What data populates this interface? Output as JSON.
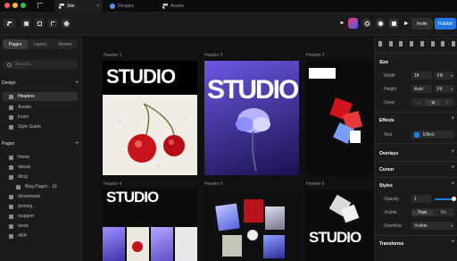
{
  "window": {
    "tabs": [
      {
        "label": "Site",
        "active": true
      },
      {
        "label": "Designs",
        "active": false
      },
      {
        "label": "Assets",
        "active": false
      }
    ]
  },
  "toolbar": {
    "invite_label": "Invite",
    "publish_label": "Publish",
    "accent": "#1e78e6"
  },
  "sidebar": {
    "tabs": [
      "Pages",
      "Layers",
      "Assets"
    ],
    "search_placeholder": "Search...",
    "design_section": "Design",
    "design_items": [
      "Headers",
      "Assets",
      "Icons",
      "Style Guide"
    ],
    "pages_section": "Pages",
    "page_items": [
      "Home",
      "/about",
      "/blog",
      "Blog Pages · 10",
      "/downloads",
      "/pricing",
      "/support",
      "/work",
      "/404"
    ]
  },
  "canvas": {
    "frames": [
      {
        "label": "Header 1",
        "heading": "STUDIO"
      },
      {
        "label": "Header 2",
        "heading": "STUDIO"
      },
      {
        "label": "Header 3",
        "heading": ""
      },
      {
        "label": "Header 4",
        "heading": "STUDIO"
      },
      {
        "label": "Header 5",
        "heading": ""
      },
      {
        "label": "Header 6",
        "heading": "STUDIO"
      }
    ]
  },
  "panel": {
    "size_title": "Size",
    "width_label": "Width",
    "width_value": "1fr",
    "width_mode": "Fill",
    "height_label": "Height",
    "height_value": "Auto",
    "height_mode": "Fit",
    "grow_label": "Grow",
    "effects_title": "Effects",
    "text_label": "Text",
    "effect_value": "Effect",
    "overlays_title": "Overlays",
    "cursor_title": "Cursor",
    "styles_title": "Styles",
    "opacity_label": "Opacity",
    "opacity_value": "1",
    "visible_label": "Visible",
    "visible_true": "True",
    "visible_false": "No",
    "overflow_label": "Overflow",
    "overflow_value": "Visible",
    "transforms_title": "Transforms"
  }
}
